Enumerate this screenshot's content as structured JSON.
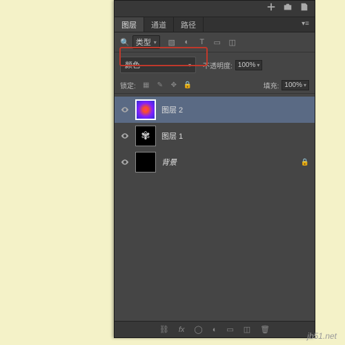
{
  "tabs": {
    "layers": "图层",
    "channels": "通道",
    "paths": "路径"
  },
  "filter": {
    "kind": "类型"
  },
  "blend": {
    "mode": "颜色",
    "opacity_label": "不透明度:",
    "opacity_value": "100%"
  },
  "lock": {
    "label": "锁定:",
    "fill_label": "填充:",
    "fill_value": "100%"
  },
  "layers_list": [
    {
      "name": "图层 2"
    },
    {
      "name": "图层 1"
    },
    {
      "name": "背景"
    }
  ],
  "watermark": "jb51.net",
  "chart_data": null
}
